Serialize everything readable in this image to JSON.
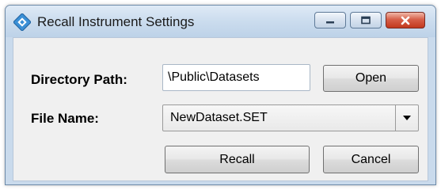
{
  "window": {
    "title": "Recall Instrument Settings",
    "controls": {
      "minimize_icon": "minimize-icon",
      "maximize_icon": "maximize-icon",
      "close_icon": "close-icon"
    }
  },
  "form": {
    "directory_label": "Directory Path:",
    "directory_value": "\\Public\\Datasets",
    "open_label": "Open",
    "file_label": "File Name:",
    "file_value": "NewDataset.SET"
  },
  "actions": {
    "recall_label": "Recall",
    "cancel_label": "Cancel"
  },
  "colors": {
    "titlebar": "#c9daec",
    "close_button": "#c2381e",
    "dialog_body": "#f0f0f0"
  }
}
